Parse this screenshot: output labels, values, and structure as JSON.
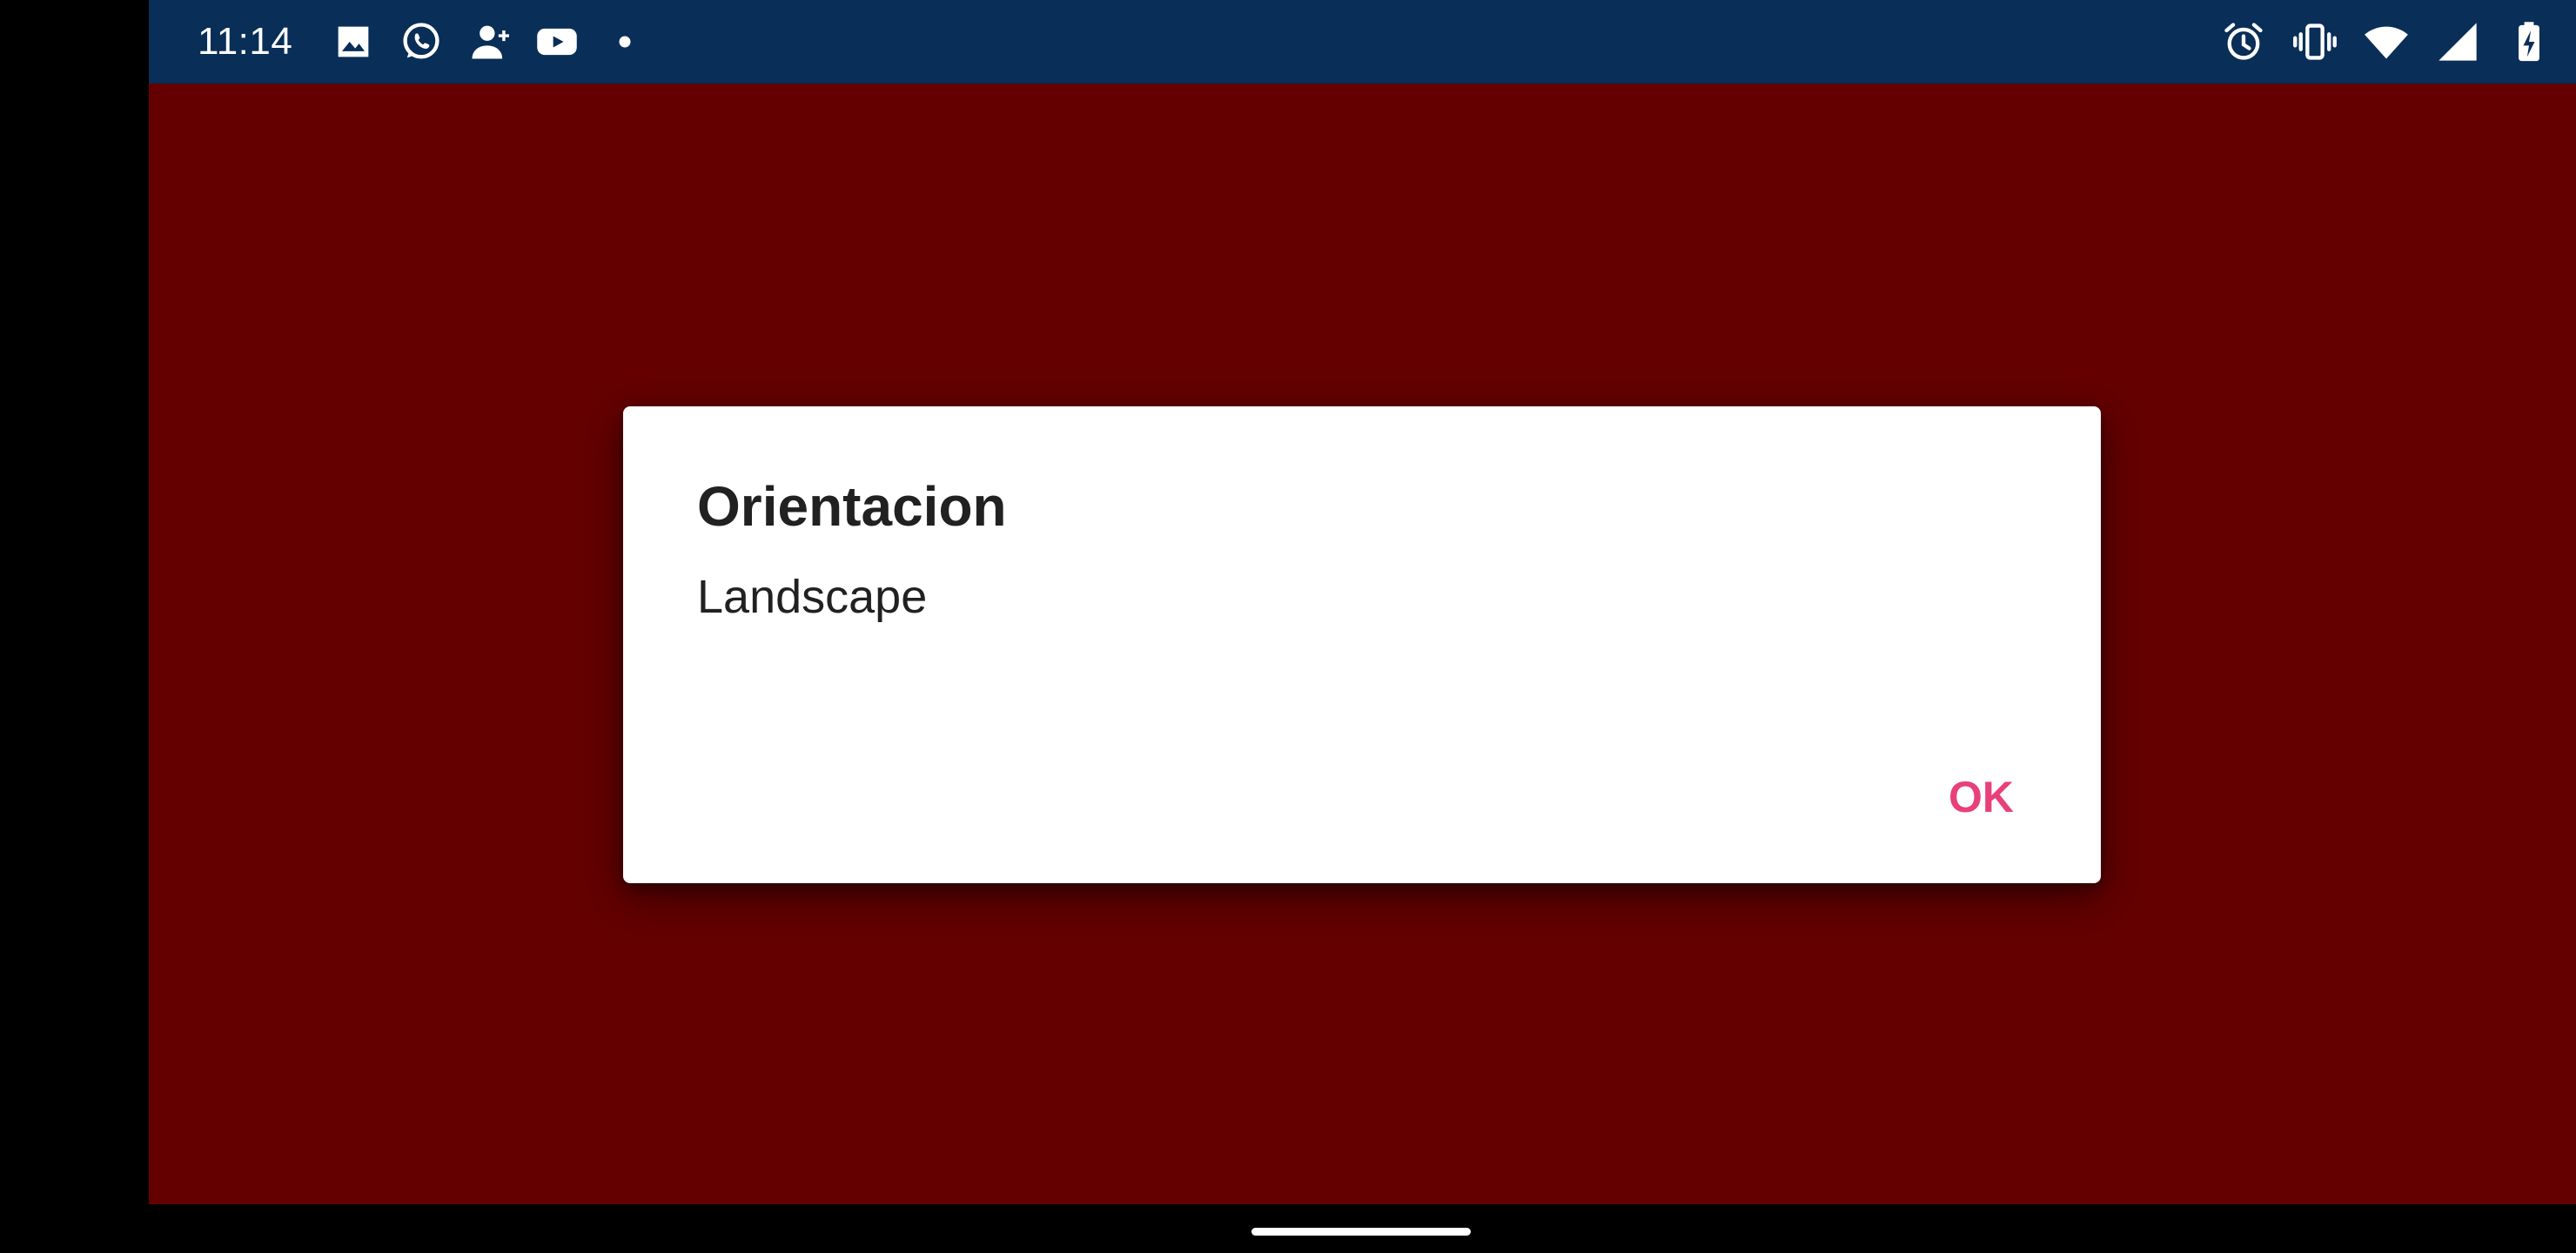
{
  "status_bar": {
    "time": "11:14",
    "background_color": "#092e57",
    "left_icons": [
      "image-icon",
      "whatsapp-icon",
      "add-contact-icon",
      "youtube-icon",
      "notification-dot-icon"
    ],
    "right_icons": [
      "alarm-icon",
      "vibrate-icon",
      "wifi-icon",
      "cell-signal-icon",
      "battery-charging-icon"
    ]
  },
  "app": {
    "background_color": "#640000"
  },
  "dialog": {
    "title": "Orientacion",
    "message": "Landscape",
    "ok_label": "OK",
    "accent_color": "#e8407b"
  },
  "navigation": {
    "gesture_handle": "home-handle"
  }
}
